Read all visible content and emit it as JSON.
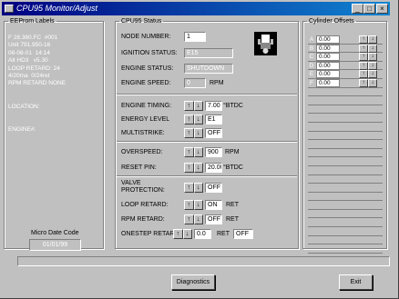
{
  "window": {
    "title": "CPU95 Monitor/Adjust",
    "min": "_",
    "max": "□",
    "close": "×"
  },
  "eeprom": {
    "legend": "EEProm Labels",
    "lines": "F 28.360.FC  #001\nUnit 791.950-16\n08-08-01  14:14\nAlt HD3   v5.30\nLOOP RETARD: 24\n4/20ma  0/24ret\nRPM RETARD NONE\n\n\nLOCATION:\n\n\nENGINE#:",
    "micro_label": "Micro Date Code",
    "micro_value": "01/01/99"
  },
  "status": {
    "legend": "CPU95 Status",
    "node_label": "NODE NUMBER:",
    "node_value": "1",
    "ign_label": "IGNITION STATUS:",
    "ign_value": "E15",
    "eng_label": "ENGINE STATUS:",
    "eng_value": "SHUTDOWN",
    "speed_label": "ENGINE SPEED:",
    "speed_value": "0",
    "speed_unit": "RPM",
    "timing_label": "ENGINE TIMING:",
    "timing_value": "7.00",
    "timing_unit": "°BTDC",
    "energy_label": "ENERGY LEVEL",
    "energy_value": "E1",
    "multi_label": "MULTISTRIKE:",
    "multi_value": "OFF",
    "over_label": "OVERSPEED:",
    "over_value": "900",
    "over_unit": "RPM",
    "reset_label": "RESET PIN:",
    "reset_value": "20.00",
    "reset_unit": "°BTDC",
    "valve_label1": "VALVE",
    "valve_label2": "PROTECTION:",
    "valve_value": "OFF",
    "loop_label": "LOOP RETARD:",
    "loop_value": "ON",
    "loop_unit": "RET",
    "rpm_label": "RPM RETARD:",
    "rpm_value": "OFF",
    "rpm_unit": "RET",
    "onestep_label": "ONESTEP RETARD",
    "onestep_value": "0.0",
    "onestep_unit": "RET",
    "onestep_state": "OFF",
    "up": "↑",
    "down": "↓"
  },
  "cylinders": {
    "legend": "Cylinder Offsets",
    "rows": [
      {
        "label": "A",
        "value": "0.00"
      },
      {
        "label": "B",
        "value": "0.00"
      },
      {
        "label": "C",
        "value": "0.00"
      },
      {
        "label": "D",
        "value": "0.00"
      },
      {
        "label": "E",
        "value": "0.00"
      },
      {
        "label": "F",
        "value": "0.00"
      }
    ]
  },
  "buttons": {
    "diagnostics": "Diagnostics",
    "exit": "Exit"
  }
}
